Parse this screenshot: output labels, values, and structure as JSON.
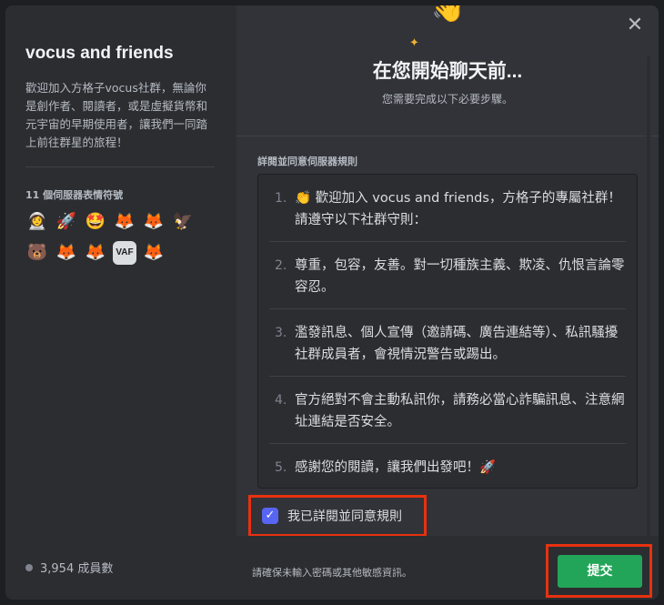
{
  "sidebar": {
    "server_name": "vocus and friends",
    "description": "歡迎加入方格子vocus社群，無論你是創作者、閱讀者，或是虛擬貨幣和元宇宙的早期使用者，讓我們一同踏上前往群星的旅程！",
    "emoji_title": "11 個伺服器表情符號",
    "emojis": [
      {
        "icon": "astronaut-emoji-icon",
        "glyph": "👩‍🚀"
      },
      {
        "icon": "rocket-emoji-icon",
        "glyph": "🚀"
      },
      {
        "icon": "face-emoji-icon",
        "glyph": "🤩"
      },
      {
        "icon": "fox-emoji-icon-1",
        "glyph": "🦊"
      },
      {
        "icon": "fox-emoji-icon-2",
        "glyph": "🦊"
      },
      {
        "icon": "bird-emoji-icon",
        "glyph": "🦅"
      },
      {
        "icon": "bear-emoji-icon",
        "glyph": "🐻"
      },
      {
        "icon": "fox-emoji-icon-3",
        "glyph": "🦊"
      },
      {
        "icon": "fox-emoji-icon-4",
        "glyph": "🦊"
      },
      {
        "icon": "vaf-emoji-icon",
        "glyph": "VAF"
      },
      {
        "icon": "fox-emoji-icon-5",
        "glyph": "🦊"
      }
    ],
    "member_count": "3,954 成員數"
  },
  "main": {
    "title": "在您開始聊天前...",
    "subtitle": "您需要完成以下必要步驟。",
    "rules_title": "詳閱並同意伺服器規則",
    "rules": [
      {
        "num": "1.",
        "text": "👏 歡迎加入 vocus and friends，方格子的專屬社群！請遵守以下社群守則："
      },
      {
        "num": "2.",
        "text": "尊重，包容，友善。對一切種族主義、欺凌、仇恨言論零容忍。"
      },
      {
        "num": "3.",
        "text": "濫發訊息、個人宣傳（邀請碼、廣告連結等）、私訊騷擾社群成員者，會視情況警告或踢出。"
      },
      {
        "num": "4.",
        "text": "官方絕對不會主動私訊你，請務必當心詐騙訊息、注意網址連結是否安全。"
      },
      {
        "num": "5.",
        "text": "感謝您的閱讀，讓我們出發吧！🚀"
      }
    ],
    "agree_label": "我已詳閱並同意規則",
    "footer_note": "請確保未輸入密碼或其他敏感資訊。",
    "submit_label": "提交"
  },
  "colors": {
    "accent": "#5865f2",
    "submit": "#23a559",
    "highlight": "#e8310f"
  }
}
